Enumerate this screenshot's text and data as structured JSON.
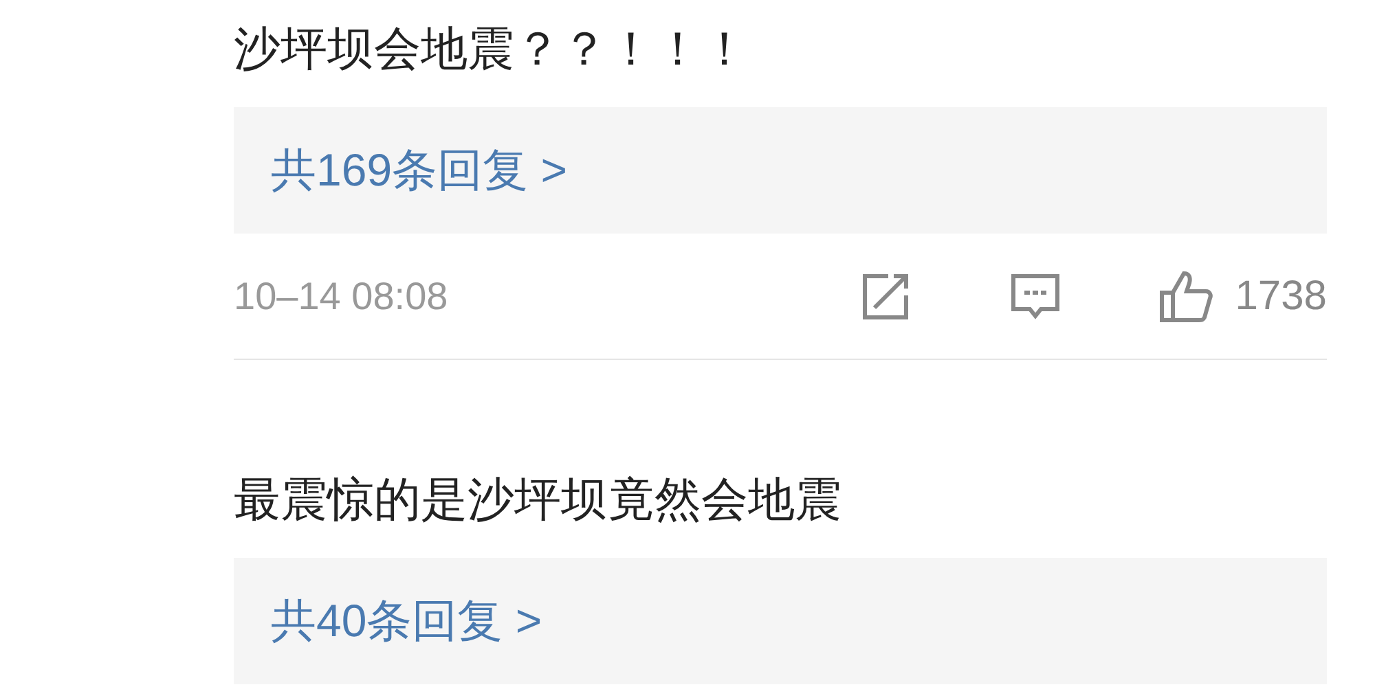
{
  "comments": [
    {
      "text": "沙坪坝会地震？？！！！",
      "replies": "共169条回复 >",
      "time": "10–14 08:08",
      "likes": "1738"
    },
    {
      "text": "最震惊的是沙坪坝竟然会地震",
      "replies": "共40条回复 >"
    }
  ]
}
